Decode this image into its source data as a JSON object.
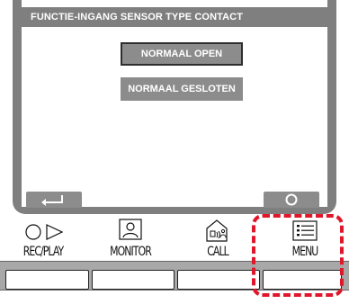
{
  "screen": {
    "title": "FUNCTIE-INGANG SENSOR TYPE CONTACT",
    "options": [
      {
        "label": "NORMAAL OPEN",
        "selected": true
      },
      {
        "label": "NORMAAL GESLOTEN",
        "selected": false
      }
    ],
    "back_button": {
      "icon": "return-arrow-icon"
    },
    "confirm_button": {
      "icon": "circle-icon"
    }
  },
  "function_buttons": [
    {
      "label": "REC/PLAY",
      "icon": "record-play-icon"
    },
    {
      "label": "MONITOR",
      "icon": "monitor-person-icon"
    },
    {
      "label": "CALL",
      "icon": "call-house-icon"
    },
    {
      "label": "MENU",
      "icon": "menu-list-icon"
    }
  ],
  "highlight": {
    "target": "MENU",
    "color": "#e0172b"
  },
  "colors": {
    "bezel": "#7f7f7f",
    "button": "#8c8c8c"
  }
}
